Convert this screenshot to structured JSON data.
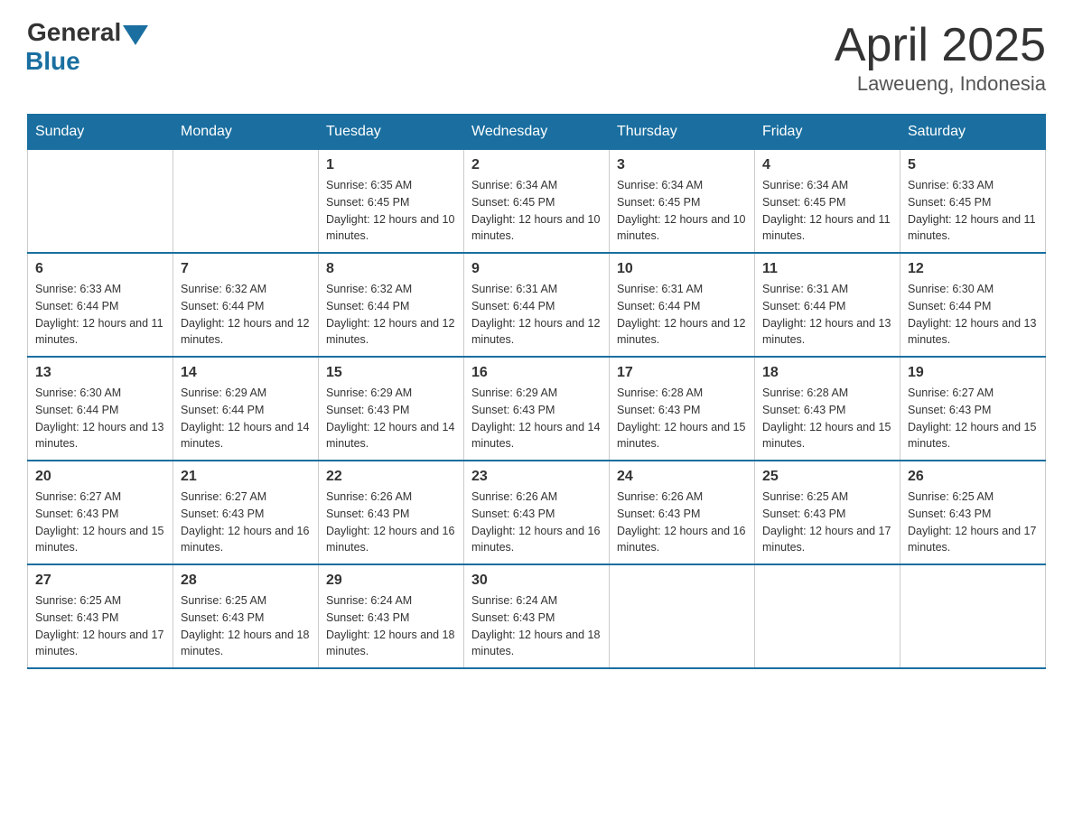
{
  "header": {
    "logo": {
      "general": "General",
      "triangle_color": "#1a6fa0",
      "blue": "Blue"
    },
    "title": "April 2025",
    "location": "Laweueng, Indonesia"
  },
  "weekdays": [
    "Sunday",
    "Monday",
    "Tuesday",
    "Wednesday",
    "Thursday",
    "Friday",
    "Saturday"
  ],
  "weeks": [
    [
      {
        "day": "",
        "sunrise": "",
        "sunset": "",
        "daylight": ""
      },
      {
        "day": "",
        "sunrise": "",
        "sunset": "",
        "daylight": ""
      },
      {
        "day": "1",
        "sunrise": "Sunrise: 6:35 AM",
        "sunset": "Sunset: 6:45 PM",
        "daylight": "Daylight: 12 hours and 10 minutes."
      },
      {
        "day": "2",
        "sunrise": "Sunrise: 6:34 AM",
        "sunset": "Sunset: 6:45 PM",
        "daylight": "Daylight: 12 hours and 10 minutes."
      },
      {
        "day": "3",
        "sunrise": "Sunrise: 6:34 AM",
        "sunset": "Sunset: 6:45 PM",
        "daylight": "Daylight: 12 hours and 10 minutes."
      },
      {
        "day": "4",
        "sunrise": "Sunrise: 6:34 AM",
        "sunset": "Sunset: 6:45 PM",
        "daylight": "Daylight: 12 hours and 11 minutes."
      },
      {
        "day": "5",
        "sunrise": "Sunrise: 6:33 AM",
        "sunset": "Sunset: 6:45 PM",
        "daylight": "Daylight: 12 hours and 11 minutes."
      }
    ],
    [
      {
        "day": "6",
        "sunrise": "Sunrise: 6:33 AM",
        "sunset": "Sunset: 6:44 PM",
        "daylight": "Daylight: 12 hours and 11 minutes."
      },
      {
        "day": "7",
        "sunrise": "Sunrise: 6:32 AM",
        "sunset": "Sunset: 6:44 PM",
        "daylight": "Daylight: 12 hours and 12 minutes."
      },
      {
        "day": "8",
        "sunrise": "Sunrise: 6:32 AM",
        "sunset": "Sunset: 6:44 PM",
        "daylight": "Daylight: 12 hours and 12 minutes."
      },
      {
        "day": "9",
        "sunrise": "Sunrise: 6:31 AM",
        "sunset": "Sunset: 6:44 PM",
        "daylight": "Daylight: 12 hours and 12 minutes."
      },
      {
        "day": "10",
        "sunrise": "Sunrise: 6:31 AM",
        "sunset": "Sunset: 6:44 PM",
        "daylight": "Daylight: 12 hours and 12 minutes."
      },
      {
        "day": "11",
        "sunrise": "Sunrise: 6:31 AM",
        "sunset": "Sunset: 6:44 PM",
        "daylight": "Daylight: 12 hours and 13 minutes."
      },
      {
        "day": "12",
        "sunrise": "Sunrise: 6:30 AM",
        "sunset": "Sunset: 6:44 PM",
        "daylight": "Daylight: 12 hours and 13 minutes."
      }
    ],
    [
      {
        "day": "13",
        "sunrise": "Sunrise: 6:30 AM",
        "sunset": "Sunset: 6:44 PM",
        "daylight": "Daylight: 12 hours and 13 minutes."
      },
      {
        "day": "14",
        "sunrise": "Sunrise: 6:29 AM",
        "sunset": "Sunset: 6:44 PM",
        "daylight": "Daylight: 12 hours and 14 minutes."
      },
      {
        "day": "15",
        "sunrise": "Sunrise: 6:29 AM",
        "sunset": "Sunset: 6:43 PM",
        "daylight": "Daylight: 12 hours and 14 minutes."
      },
      {
        "day": "16",
        "sunrise": "Sunrise: 6:29 AM",
        "sunset": "Sunset: 6:43 PM",
        "daylight": "Daylight: 12 hours and 14 minutes."
      },
      {
        "day": "17",
        "sunrise": "Sunrise: 6:28 AM",
        "sunset": "Sunset: 6:43 PM",
        "daylight": "Daylight: 12 hours and 15 minutes."
      },
      {
        "day": "18",
        "sunrise": "Sunrise: 6:28 AM",
        "sunset": "Sunset: 6:43 PM",
        "daylight": "Daylight: 12 hours and 15 minutes."
      },
      {
        "day": "19",
        "sunrise": "Sunrise: 6:27 AM",
        "sunset": "Sunset: 6:43 PM",
        "daylight": "Daylight: 12 hours and 15 minutes."
      }
    ],
    [
      {
        "day": "20",
        "sunrise": "Sunrise: 6:27 AM",
        "sunset": "Sunset: 6:43 PM",
        "daylight": "Daylight: 12 hours and 15 minutes."
      },
      {
        "day": "21",
        "sunrise": "Sunrise: 6:27 AM",
        "sunset": "Sunset: 6:43 PM",
        "daylight": "Daylight: 12 hours and 16 minutes."
      },
      {
        "day": "22",
        "sunrise": "Sunrise: 6:26 AM",
        "sunset": "Sunset: 6:43 PM",
        "daylight": "Daylight: 12 hours and 16 minutes."
      },
      {
        "day": "23",
        "sunrise": "Sunrise: 6:26 AM",
        "sunset": "Sunset: 6:43 PM",
        "daylight": "Daylight: 12 hours and 16 minutes."
      },
      {
        "day": "24",
        "sunrise": "Sunrise: 6:26 AM",
        "sunset": "Sunset: 6:43 PM",
        "daylight": "Daylight: 12 hours and 16 minutes."
      },
      {
        "day": "25",
        "sunrise": "Sunrise: 6:25 AM",
        "sunset": "Sunset: 6:43 PM",
        "daylight": "Daylight: 12 hours and 17 minutes."
      },
      {
        "day": "26",
        "sunrise": "Sunrise: 6:25 AM",
        "sunset": "Sunset: 6:43 PM",
        "daylight": "Daylight: 12 hours and 17 minutes."
      }
    ],
    [
      {
        "day": "27",
        "sunrise": "Sunrise: 6:25 AM",
        "sunset": "Sunset: 6:43 PM",
        "daylight": "Daylight: 12 hours and 17 minutes."
      },
      {
        "day": "28",
        "sunrise": "Sunrise: 6:25 AM",
        "sunset": "Sunset: 6:43 PM",
        "daylight": "Daylight: 12 hours and 18 minutes."
      },
      {
        "day": "29",
        "sunrise": "Sunrise: 6:24 AM",
        "sunset": "Sunset: 6:43 PM",
        "daylight": "Daylight: 12 hours and 18 minutes."
      },
      {
        "day": "30",
        "sunrise": "Sunrise: 6:24 AM",
        "sunset": "Sunset: 6:43 PM",
        "daylight": "Daylight: 12 hours and 18 minutes."
      },
      {
        "day": "",
        "sunrise": "",
        "sunset": "",
        "daylight": ""
      },
      {
        "day": "",
        "sunrise": "",
        "sunset": "",
        "daylight": ""
      },
      {
        "day": "",
        "sunrise": "",
        "sunset": "",
        "daylight": ""
      }
    ]
  ]
}
